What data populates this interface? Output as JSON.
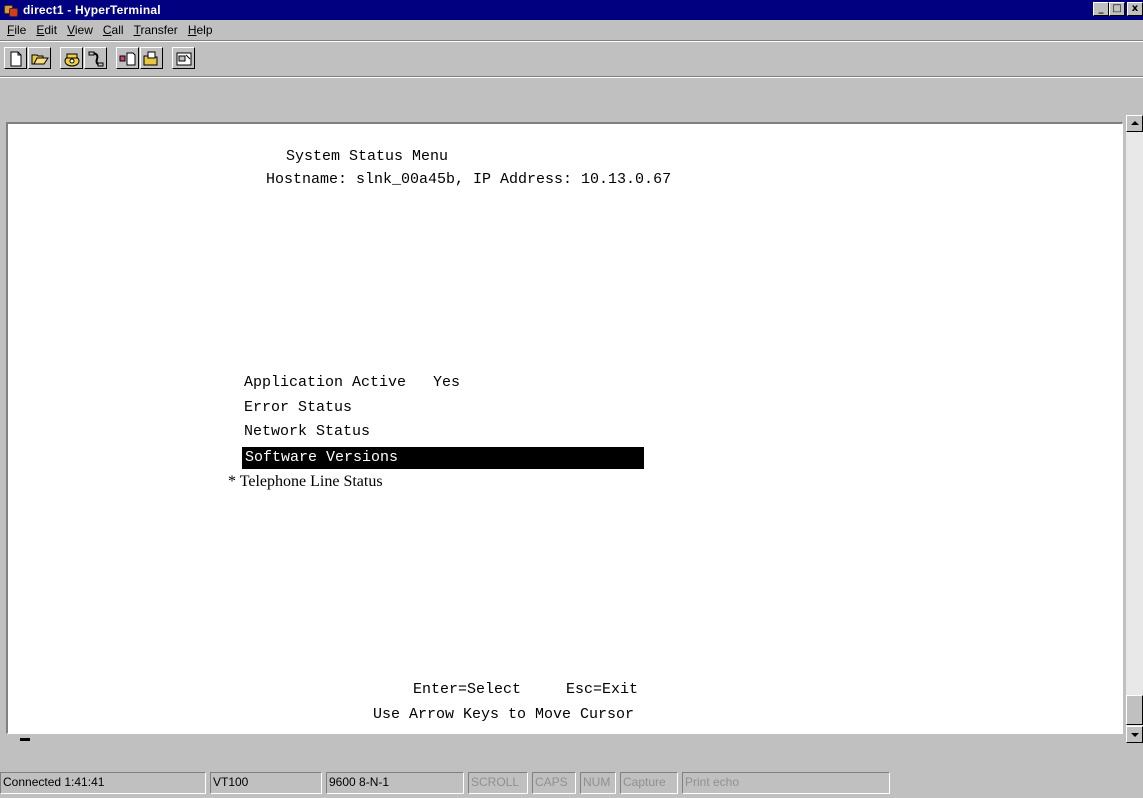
{
  "window": {
    "title": "direct1 - HyperTerminal",
    "controls": {
      "minimize": "_",
      "maximize": "□",
      "close": "x"
    }
  },
  "menu": {
    "items": [
      {
        "key": "F",
        "rest": "ile"
      },
      {
        "key": "E",
        "rest": "dit"
      },
      {
        "key": "V",
        "rest": "iew"
      },
      {
        "key": "C",
        "rest": "all"
      },
      {
        "key": "T",
        "rest": "ransfer"
      },
      {
        "key": "H",
        "rest": "elp"
      }
    ]
  },
  "toolbar": {
    "icons": [
      "new-icon",
      "open-icon",
      "connect-icon",
      "disconnect-icon",
      "send-icon",
      "receive-icon",
      "properties-icon"
    ]
  },
  "terminal": {
    "heading": "System Status Menu",
    "host_line": "Hostname: slnk_00a45b, IP Address: 10.13.0.67",
    "menu_items": [
      {
        "label": "Application Active",
        "value": "Yes"
      },
      {
        "label": "Error Status"
      },
      {
        "label": "Network Status"
      },
      {
        "label": "Software Versions",
        "selected": true
      }
    ],
    "note": "* Telephone Line Status",
    "help_line_1": "Enter=Select     Esc=Exit",
    "help_line_2": "Use Arrow Keys to Move Cursor"
  },
  "statusbar": {
    "connected": "Connected 1:41:41",
    "emulation": "VT100",
    "settings": "9600 8-N-1",
    "scroll": "SCROLL",
    "caps": "CAPS",
    "num": "NUM",
    "capture": "Capture",
    "print_echo": "Print echo"
  }
}
